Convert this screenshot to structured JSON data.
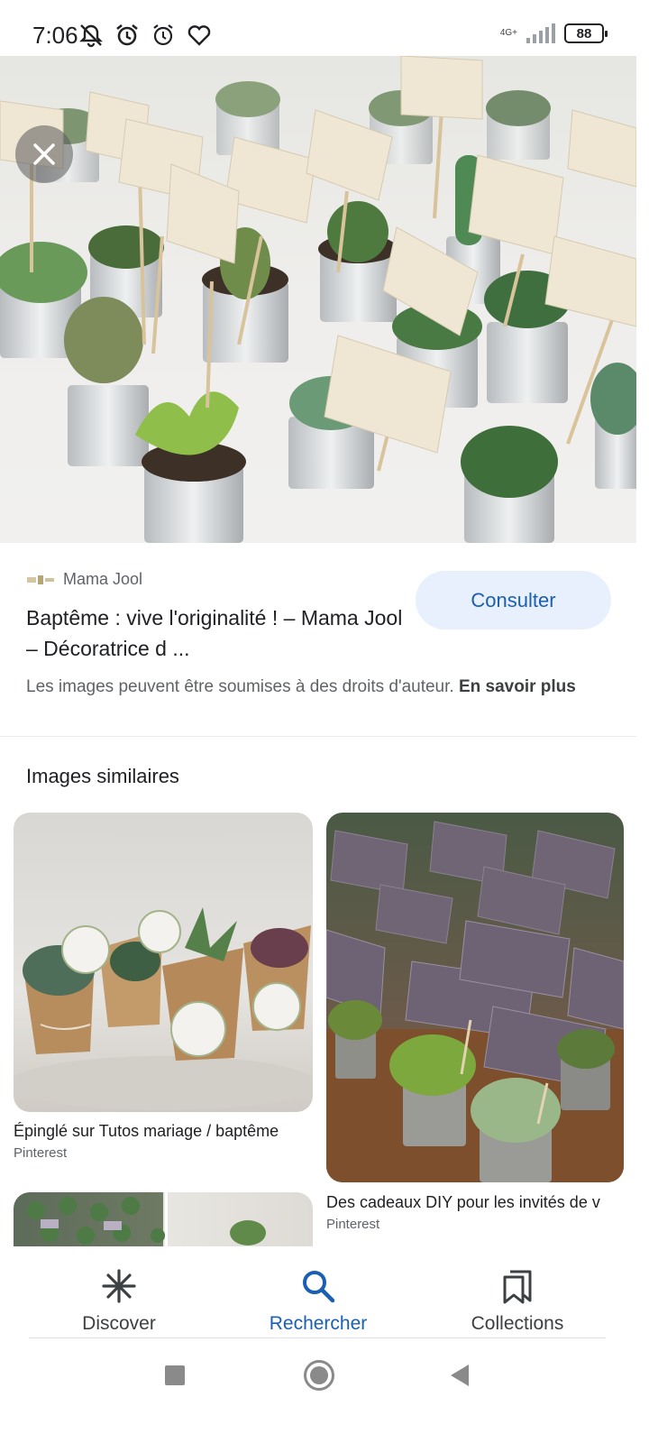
{
  "status_bar": {
    "time": "7:06",
    "network": "4G+",
    "battery": "88"
  },
  "hero": {
    "description_icon": "close-icon"
  },
  "result": {
    "source_name": "Mama Jool",
    "title": "Baptême : vive l'originalité ! – Mama Jool – Décoratrice d ...",
    "consult_label": "Consulter",
    "copyright_text": "Les images peuvent être soumises à des droits d'auteur.",
    "learn_more": "En savoir plus"
  },
  "similar": {
    "heading": "Images similaires",
    "cards": [
      {
        "caption": "Épinglé sur Tutos mariage / baptême",
        "source": "Pinterest"
      },
      {
        "caption": "Des cadeaux DIY pour les invités de v",
        "source": "Pinterest"
      }
    ]
  },
  "bottom_nav": {
    "items": [
      {
        "label": "Discover",
        "icon": "asterisk-icon"
      },
      {
        "label": "Rechercher",
        "icon": "search-icon"
      },
      {
        "label": "Collections",
        "icon": "bookmarks-icon"
      }
    ],
    "active": "Rechercher"
  },
  "colors": {
    "accent": "#1a5fb4",
    "consult_bg": "#e8f0fe",
    "text_secondary": "#5f6368"
  }
}
